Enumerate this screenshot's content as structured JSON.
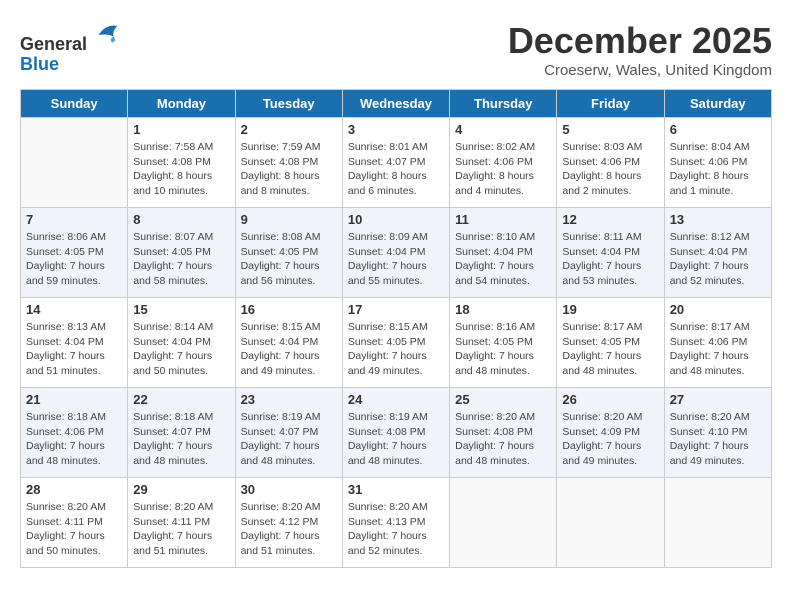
{
  "logo": {
    "line1": "General",
    "line2": "Blue"
  },
  "title": "December 2025",
  "location": "Croeserw, Wales, United Kingdom",
  "days_of_week": [
    "Sunday",
    "Monday",
    "Tuesday",
    "Wednesday",
    "Thursday",
    "Friday",
    "Saturday"
  ],
  "weeks": [
    [
      {
        "day": "",
        "info": ""
      },
      {
        "day": "1",
        "info": "Sunrise: 7:58 AM\nSunset: 4:08 PM\nDaylight: 8 hours\nand 10 minutes."
      },
      {
        "day": "2",
        "info": "Sunrise: 7:59 AM\nSunset: 4:08 PM\nDaylight: 8 hours\nand 8 minutes."
      },
      {
        "day": "3",
        "info": "Sunrise: 8:01 AM\nSunset: 4:07 PM\nDaylight: 8 hours\nand 6 minutes."
      },
      {
        "day": "4",
        "info": "Sunrise: 8:02 AM\nSunset: 4:06 PM\nDaylight: 8 hours\nand 4 minutes."
      },
      {
        "day": "5",
        "info": "Sunrise: 8:03 AM\nSunset: 4:06 PM\nDaylight: 8 hours\nand 2 minutes."
      },
      {
        "day": "6",
        "info": "Sunrise: 8:04 AM\nSunset: 4:06 PM\nDaylight: 8 hours\nand 1 minute."
      }
    ],
    [
      {
        "day": "7",
        "info": "Sunrise: 8:06 AM\nSunset: 4:05 PM\nDaylight: 7 hours\nand 59 minutes."
      },
      {
        "day": "8",
        "info": "Sunrise: 8:07 AM\nSunset: 4:05 PM\nDaylight: 7 hours\nand 58 minutes."
      },
      {
        "day": "9",
        "info": "Sunrise: 8:08 AM\nSunset: 4:05 PM\nDaylight: 7 hours\nand 56 minutes."
      },
      {
        "day": "10",
        "info": "Sunrise: 8:09 AM\nSunset: 4:04 PM\nDaylight: 7 hours\nand 55 minutes."
      },
      {
        "day": "11",
        "info": "Sunrise: 8:10 AM\nSunset: 4:04 PM\nDaylight: 7 hours\nand 54 minutes."
      },
      {
        "day": "12",
        "info": "Sunrise: 8:11 AM\nSunset: 4:04 PM\nDaylight: 7 hours\nand 53 minutes."
      },
      {
        "day": "13",
        "info": "Sunrise: 8:12 AM\nSunset: 4:04 PM\nDaylight: 7 hours\nand 52 minutes."
      }
    ],
    [
      {
        "day": "14",
        "info": "Sunrise: 8:13 AM\nSunset: 4:04 PM\nDaylight: 7 hours\nand 51 minutes."
      },
      {
        "day": "15",
        "info": "Sunrise: 8:14 AM\nSunset: 4:04 PM\nDaylight: 7 hours\nand 50 minutes."
      },
      {
        "day": "16",
        "info": "Sunrise: 8:15 AM\nSunset: 4:04 PM\nDaylight: 7 hours\nand 49 minutes."
      },
      {
        "day": "17",
        "info": "Sunrise: 8:15 AM\nSunset: 4:05 PM\nDaylight: 7 hours\nand 49 minutes."
      },
      {
        "day": "18",
        "info": "Sunrise: 8:16 AM\nSunset: 4:05 PM\nDaylight: 7 hours\nand 48 minutes."
      },
      {
        "day": "19",
        "info": "Sunrise: 8:17 AM\nSunset: 4:05 PM\nDaylight: 7 hours\nand 48 minutes."
      },
      {
        "day": "20",
        "info": "Sunrise: 8:17 AM\nSunset: 4:06 PM\nDaylight: 7 hours\nand 48 minutes."
      }
    ],
    [
      {
        "day": "21",
        "info": "Sunrise: 8:18 AM\nSunset: 4:06 PM\nDaylight: 7 hours\nand 48 minutes."
      },
      {
        "day": "22",
        "info": "Sunrise: 8:18 AM\nSunset: 4:07 PM\nDaylight: 7 hours\nand 48 minutes."
      },
      {
        "day": "23",
        "info": "Sunrise: 8:19 AM\nSunset: 4:07 PM\nDaylight: 7 hours\nand 48 minutes."
      },
      {
        "day": "24",
        "info": "Sunrise: 8:19 AM\nSunset: 4:08 PM\nDaylight: 7 hours\nand 48 minutes."
      },
      {
        "day": "25",
        "info": "Sunrise: 8:20 AM\nSunset: 4:08 PM\nDaylight: 7 hours\nand 48 minutes."
      },
      {
        "day": "26",
        "info": "Sunrise: 8:20 AM\nSunset: 4:09 PM\nDaylight: 7 hours\nand 49 minutes."
      },
      {
        "day": "27",
        "info": "Sunrise: 8:20 AM\nSunset: 4:10 PM\nDaylight: 7 hours\nand 49 minutes."
      }
    ],
    [
      {
        "day": "28",
        "info": "Sunrise: 8:20 AM\nSunset: 4:11 PM\nDaylight: 7 hours\nand 50 minutes."
      },
      {
        "day": "29",
        "info": "Sunrise: 8:20 AM\nSunset: 4:11 PM\nDaylight: 7 hours\nand 51 minutes."
      },
      {
        "day": "30",
        "info": "Sunrise: 8:20 AM\nSunset: 4:12 PM\nDaylight: 7 hours\nand 51 minutes."
      },
      {
        "day": "31",
        "info": "Sunrise: 8:20 AM\nSunset: 4:13 PM\nDaylight: 7 hours\nand 52 minutes."
      },
      {
        "day": "",
        "info": ""
      },
      {
        "day": "",
        "info": ""
      },
      {
        "day": "",
        "info": ""
      }
    ]
  ]
}
